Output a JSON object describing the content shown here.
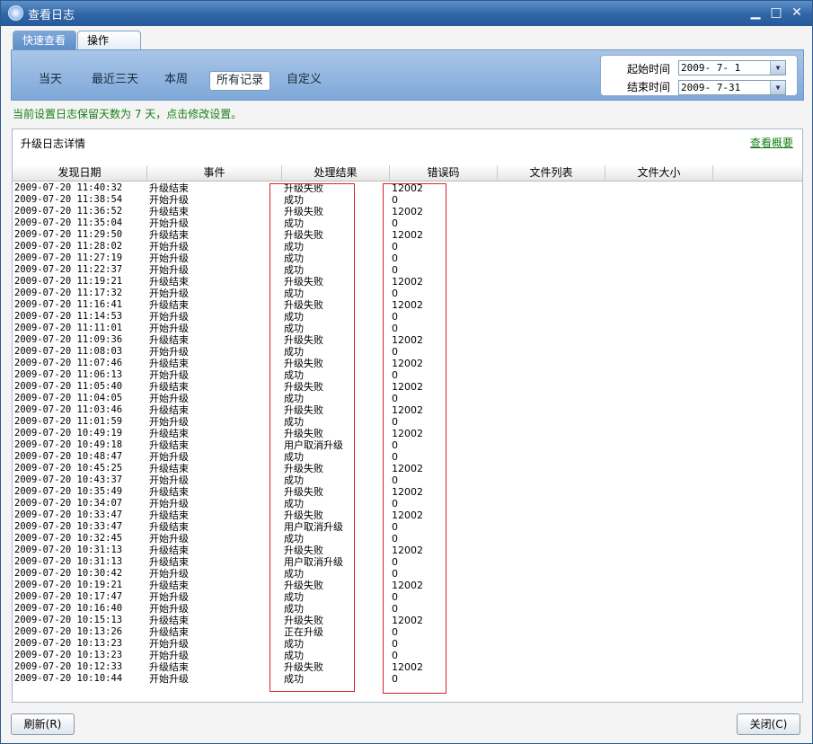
{
  "window": {
    "title": "查看日志",
    "controls": {
      "minimize": "▁",
      "maximize": "□",
      "close": "✕"
    }
  },
  "tabs": [
    {
      "label": "快速查看",
      "active": true
    },
    {
      "label": "操作",
      "active": false
    }
  ],
  "ranges": [
    {
      "label": "当天",
      "selected": false
    },
    {
      "label": "最近三天",
      "selected": false
    },
    {
      "label": "本周",
      "selected": false
    },
    {
      "label": "所有记录",
      "selected": true
    },
    {
      "label": "自定义",
      "selected": false
    }
  ],
  "date_filter": {
    "start_label": "起始时间",
    "start_value": "2009- 7- 1",
    "end_label": "结束时间",
    "end_value": "2009- 7-31"
  },
  "notice": "当前设置日志保留天数为 7 天，点击修改设置。",
  "panel": {
    "title": "升级日志详情",
    "summary_link": "查看概要"
  },
  "table": {
    "columns": [
      "发现日期",
      "事件",
      "处理结果",
      "错误码",
      "文件列表",
      "文件大小"
    ],
    "rows": [
      [
        "2009-07-20 11:40:32",
        "升级结束",
        "升级失败",
        "12002"
      ],
      [
        "2009-07-20 11:38:54",
        "开始升级",
        "成功",
        "0"
      ],
      [
        "2009-07-20 11:36:52",
        "升级结束",
        "升级失败",
        "12002"
      ],
      [
        "2009-07-20 11:35:04",
        "开始升级",
        "成功",
        "0"
      ],
      [
        "2009-07-20 11:29:50",
        "升级结束",
        "升级失败",
        "12002"
      ],
      [
        "2009-07-20 11:28:02",
        "开始升级",
        "成功",
        "0"
      ],
      [
        "2009-07-20 11:27:19",
        "开始升级",
        "成功",
        "0"
      ],
      [
        "2009-07-20 11:22:37",
        "开始升级",
        "成功",
        "0"
      ],
      [
        "2009-07-20 11:19:21",
        "升级结束",
        "升级失败",
        "12002"
      ],
      [
        "2009-07-20 11:17:32",
        "开始升级",
        "成功",
        "0"
      ],
      [
        "2009-07-20 11:16:41",
        "升级结束",
        "升级失败",
        "12002"
      ],
      [
        "2009-07-20 11:14:53",
        "开始升级",
        "成功",
        "0"
      ],
      [
        "2009-07-20 11:11:01",
        "开始升级",
        "成功",
        "0"
      ],
      [
        "2009-07-20 11:09:36",
        "升级结束",
        "升级失败",
        "12002"
      ],
      [
        "2009-07-20 11:08:03",
        "开始升级",
        "成功",
        "0"
      ],
      [
        "2009-07-20 11:07:46",
        "升级结束",
        "升级失败",
        "12002"
      ],
      [
        "2009-07-20 11:06:13",
        "开始升级",
        "成功",
        "0"
      ],
      [
        "2009-07-20 11:05:40",
        "升级结束",
        "升级失败",
        "12002"
      ],
      [
        "2009-07-20 11:04:05",
        "开始升级",
        "成功",
        "0"
      ],
      [
        "2009-07-20 11:03:46",
        "升级结束",
        "升级失败",
        "12002"
      ],
      [
        "2009-07-20 11:01:59",
        "开始升级",
        "成功",
        "0"
      ],
      [
        "2009-07-20 10:49:19",
        "升级结束",
        "升级失败",
        "12002"
      ],
      [
        "2009-07-20 10:49:18",
        "升级结束",
        "用户取消升级",
        "0"
      ],
      [
        "2009-07-20 10:48:47",
        "开始升级",
        "成功",
        "0"
      ],
      [
        "2009-07-20 10:45:25",
        "升级结束",
        "升级失败",
        "12002"
      ],
      [
        "2009-07-20 10:43:37",
        "开始升级",
        "成功",
        "0"
      ],
      [
        "2009-07-20 10:35:49",
        "升级结束",
        "升级失败",
        "12002"
      ],
      [
        "2009-07-20 10:34:07",
        "开始升级",
        "成功",
        "0"
      ],
      [
        "2009-07-20 10:33:47",
        "升级结束",
        "升级失败",
        "12002"
      ],
      [
        "2009-07-20 10:33:47",
        "升级结束",
        "用户取消升级",
        "0"
      ],
      [
        "2009-07-20 10:32:45",
        "开始升级",
        "成功",
        "0"
      ],
      [
        "2009-07-20 10:31:13",
        "升级结束",
        "升级失败",
        "12002"
      ],
      [
        "2009-07-20 10:31:13",
        "升级结束",
        "用户取消升级",
        "0"
      ],
      [
        "2009-07-20 10:30:42",
        "开始升级",
        "成功",
        "0"
      ],
      [
        "2009-07-20 10:19:21",
        "升级结束",
        "升级失败",
        "12002"
      ],
      [
        "2009-07-20 10:17:47",
        "开始升级",
        "成功",
        "0"
      ],
      [
        "2009-07-20 10:16:40",
        "开始升级",
        "成功",
        "0"
      ],
      [
        "2009-07-20 10:15:13",
        "升级结束",
        "升级失败",
        "12002"
      ],
      [
        "2009-07-20 10:13:26",
        "升级结束",
        "正在升级",
        "0"
      ],
      [
        "2009-07-20 10:13:23",
        "开始升级",
        "成功",
        "0"
      ],
      [
        "2009-07-20 10:13:23",
        "开始升级",
        "成功",
        "0"
      ],
      [
        "2009-07-20 10:12:33",
        "升级结束",
        "升级失败",
        "12002"
      ],
      [
        "2009-07-20 10:10:44",
        "开始升级",
        "成功",
        "0"
      ]
    ]
  },
  "buttons": {
    "refresh": "刷新(R)",
    "close": "关闭(C)"
  },
  "colors": {
    "title_bar": "#2f65a6",
    "notice_text": "#178017",
    "highlight_box": "#d9242c"
  }
}
